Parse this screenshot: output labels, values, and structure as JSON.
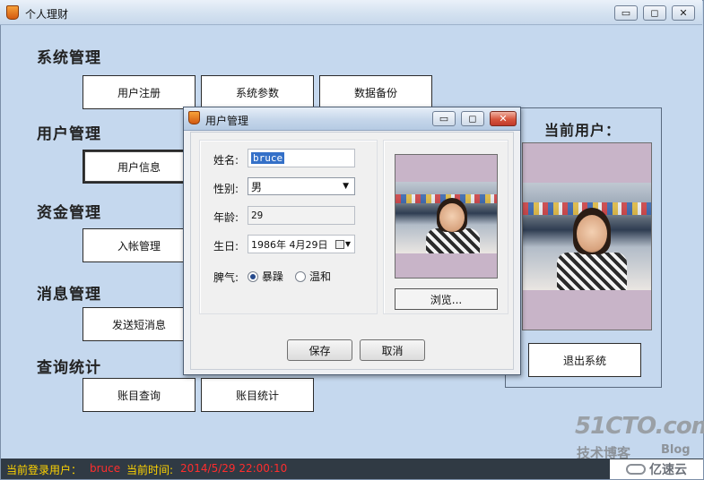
{
  "window": {
    "title": "个人理财",
    "minimize_glyph": "▭",
    "maximize_glyph": "◻",
    "close_glyph": "✕"
  },
  "sections": [
    {
      "title": "系统管理",
      "buttons": [
        "用户注册",
        "系统参数",
        "数据备份"
      ]
    },
    {
      "title": "用户管理",
      "buttons": [
        "用户信息"
      ]
    },
    {
      "title": "资金管理",
      "buttons": [
        "入帐管理"
      ]
    },
    {
      "title": "消息管理",
      "buttons": [
        "发送短消息"
      ]
    },
    {
      "title": "查询统计",
      "buttons": [
        "账目查询",
        "账目统计"
      ]
    }
  ],
  "current_user_panel": {
    "title": "当前用户：",
    "exit_button": "退出系统"
  },
  "dialog": {
    "title": "用户管理",
    "name_label": "姓名:",
    "name_value": "bruce",
    "gender_label": "性别:",
    "gender_value": "男",
    "age_label": "年龄:",
    "age_value": "29",
    "birthday_label": "生日:",
    "birthday_value": "1986年 4月29日",
    "temper_label": "脾气:",
    "temper_options": [
      "暴躁",
      "温和"
    ],
    "temper_selected": "暴躁",
    "browse_button": "浏览...",
    "save_button": "保存",
    "cancel_button": "取消"
  },
  "status": {
    "login_label": "当前登录用户：",
    "login_value": "bruce",
    "time_label": "当前时间:",
    "time_value": "2014/5/29 22:00:10"
  },
  "watermark": {
    "line1": "51CTO.com",
    "line2": "技术博客",
    "line3": "Blog",
    "line4": "亿速云"
  },
  "colors": {
    "client_bg": "#c5d8ee",
    "status_bg": "#303a44",
    "status_label": "#ffd400",
    "status_value": "#ff2d2d"
  }
}
